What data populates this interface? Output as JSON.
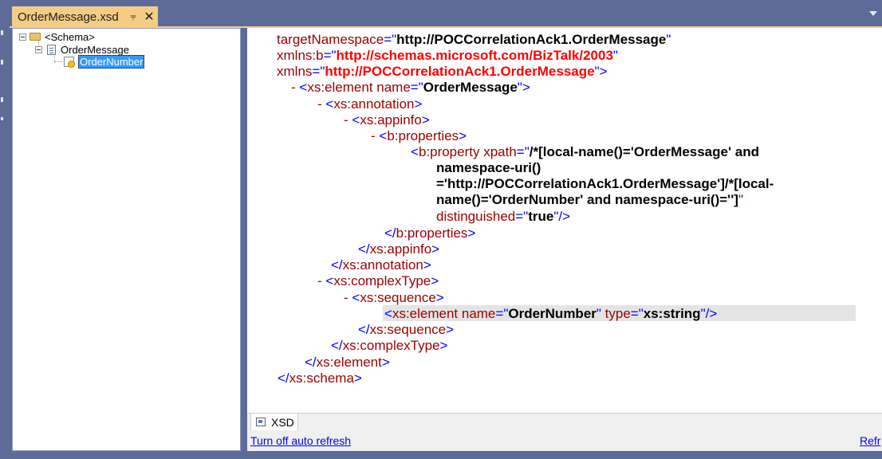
{
  "document_tab": {
    "title": "OrderMessage.xsd",
    "pin_glyph": "⫧",
    "close_glyph": "✕"
  },
  "schema_tree": {
    "root": "<Schema>",
    "record": "OrderMessage",
    "field": "OrderNumber"
  },
  "xml": {
    "l1": {
      "attr": "targetNamespace",
      "eq": "=\"",
      "val": "http://POCCorrelationAck1.OrderMessage",
      "close": "\""
    },
    "l2": {
      "attr": "xmlns:b",
      "eq": "=\"",
      "val": "http://schemas.microsoft.com/BizTalk/2003",
      "close": "\""
    },
    "l3": {
      "attr": "xmlns",
      "eq": "=\"",
      "val": "http://POCCorrelationAck1.OrderMessage",
      "close": "\">"
    },
    "l4": {
      "minus": "-",
      "open": "<",
      "elem": "xs:element",
      "attr": " name",
      "eq": "=\"",
      "val": "OrderMessage",
      "close": "\">"
    },
    "l5": {
      "minus": "-",
      "open": "<",
      "elem": "xs:annotation",
      "close": ">"
    },
    "l6": {
      "minus": "-",
      "open": "<",
      "elem": "xs:appinfo",
      "close": ">"
    },
    "l7": {
      "minus": "-",
      "open": "<",
      "elem": "b:properties",
      "close": ">"
    },
    "l8": {
      "open": "<",
      "elem": "b:property",
      "attr": " xpath",
      "eq": "=\"",
      "val": "/*[local-name()='OrderMessage' and"
    },
    "l9": {
      "val": "namespace-uri()"
    },
    "l10": {
      "val": "='http://POCCorrelationAck1.OrderMessage']/*[local-"
    },
    "l11": {
      "val": "name()='OrderNumber' and namespace-uri()='']",
      "close": "\""
    },
    "l12": {
      "attr": "distinguished",
      "eq": "=\"",
      "val": "true",
      "close": "\"/>"
    },
    "l13": {
      "open": "</",
      "elem": "b:properties",
      "close": ">"
    },
    "l14": {
      "open": "</",
      "elem": "xs:appinfo",
      "close": ">"
    },
    "l15": {
      "open": "</",
      "elem": "xs:annotation",
      "close": ">"
    },
    "l16": {
      "minus": "-",
      "open": "<",
      "elem": "xs:complexType",
      "close": ">"
    },
    "l17": {
      "minus": "-",
      "open": "<",
      "elem": "xs:sequence",
      "close": ">"
    },
    "l18": {
      "open": "<",
      "elem": "xs:element",
      "attr1": " name",
      "eq1": "=\"",
      "val1": "OrderNumber",
      "q1": "\"",
      "attr2": " type",
      "eq2": "=\"",
      "val2": "xs:string",
      "close": "\"/>"
    },
    "l19": {
      "open": "</",
      "elem": "xs:sequence",
      "close": ">"
    },
    "l20": {
      "open": "</",
      "elem": "xs:complexType",
      "close": ">"
    },
    "l21": {
      "open": "</",
      "elem": "xs:element",
      "close": ">"
    },
    "l22": {
      "open": "</",
      "elem": "xs:schema",
      "close": ">"
    }
  },
  "bottom": {
    "xsd_tab_label": "XSD",
    "auto_refresh_link": "Turn off auto refresh",
    "refresh_link": "Refr"
  },
  "colors": {
    "chrome_blue": "#5d6b99",
    "tab_gold": "#f5cc84",
    "xml_element": "#990000",
    "xml_bracket": "#0000ff",
    "xml_namespace": "#ff0000",
    "selection": "#3399ff"
  },
  "icons": [
    "folder-icon",
    "schema-record-icon",
    "field-key-icon",
    "pin-icon",
    "close-icon",
    "dropdown-arrow-icon",
    "xsd-view-icon"
  ]
}
